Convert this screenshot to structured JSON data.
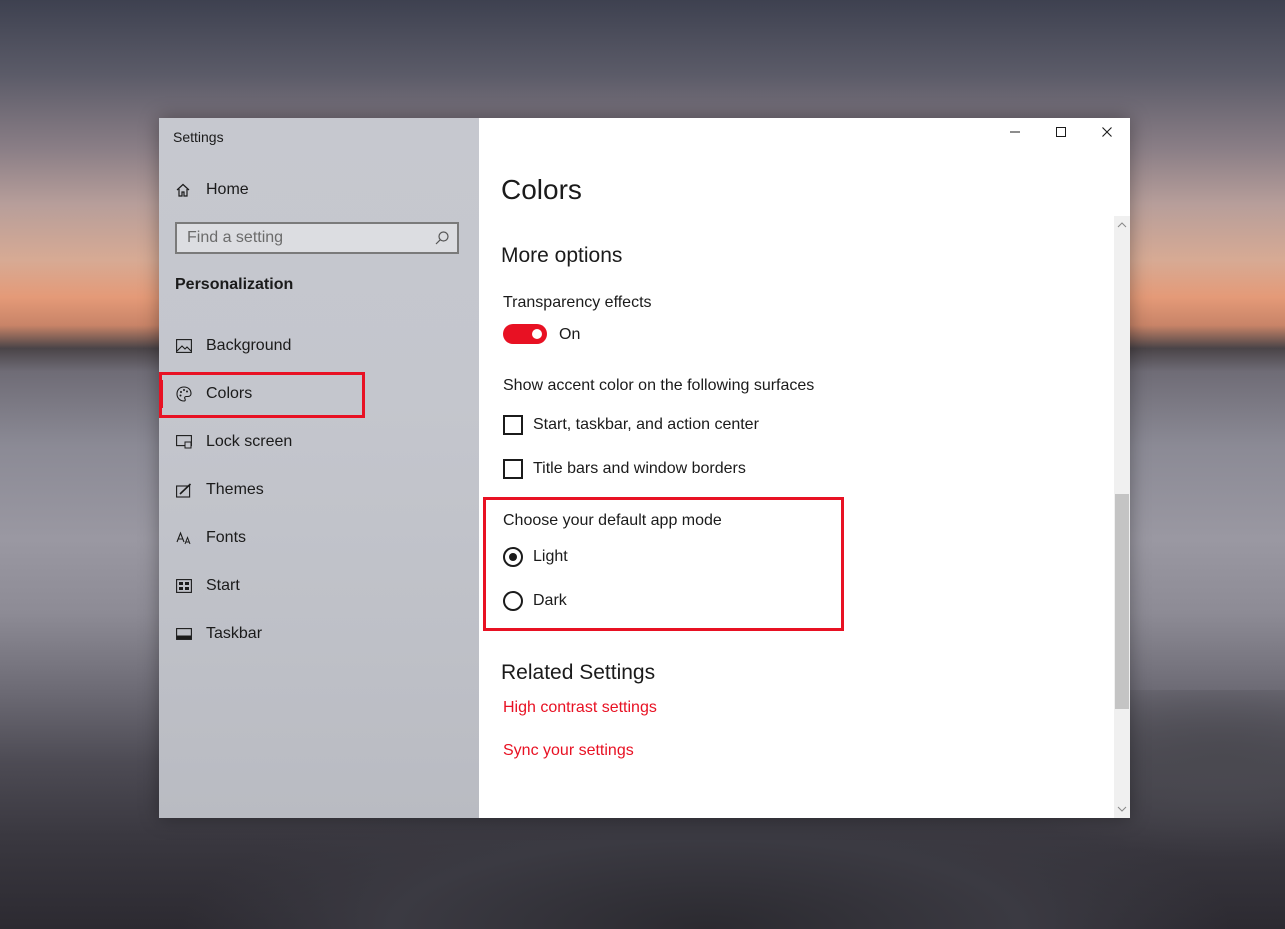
{
  "window": {
    "app_title": "Settings",
    "controls": {
      "minimize_icon": "minimize-icon",
      "maximize_icon": "maximize-icon",
      "close_icon": "close-icon"
    }
  },
  "sidebar": {
    "home_label": "Home",
    "search_placeholder": "Find a setting",
    "section_label": "Personalization",
    "items": [
      {
        "label": "Background",
        "icon": "picture-icon",
        "selected": false
      },
      {
        "label": "Colors",
        "icon": "palette-icon",
        "selected": true
      },
      {
        "label": "Lock screen",
        "icon": "lock-screen-icon",
        "selected": false
      },
      {
        "label": "Themes",
        "icon": "brush-icon",
        "selected": false
      },
      {
        "label": "Fonts",
        "icon": "font-icon",
        "selected": false
      },
      {
        "label": "Start",
        "icon": "start-icon",
        "selected": false
      },
      {
        "label": "Taskbar",
        "icon": "taskbar-icon",
        "selected": false
      }
    ]
  },
  "main": {
    "page_title": "Colors",
    "more_options_heading": "More options",
    "transparency_label": "Transparency effects",
    "transparency_state": "On",
    "accent_surfaces_label": "Show accent color on the following surfaces",
    "checkboxes": [
      {
        "label": "Start, taskbar, and action center",
        "checked": false
      },
      {
        "label": "Title bars and window borders",
        "checked": false
      }
    ],
    "app_mode_label": "Choose your default app mode",
    "app_mode_options": [
      {
        "label": "Light",
        "selected": true
      },
      {
        "label": "Dark",
        "selected": false
      }
    ],
    "related_heading": "Related Settings",
    "links": [
      "High contrast settings",
      "Sync your settings"
    ]
  },
  "colors": {
    "accent": "#e81123",
    "highlight": "#e81123"
  }
}
